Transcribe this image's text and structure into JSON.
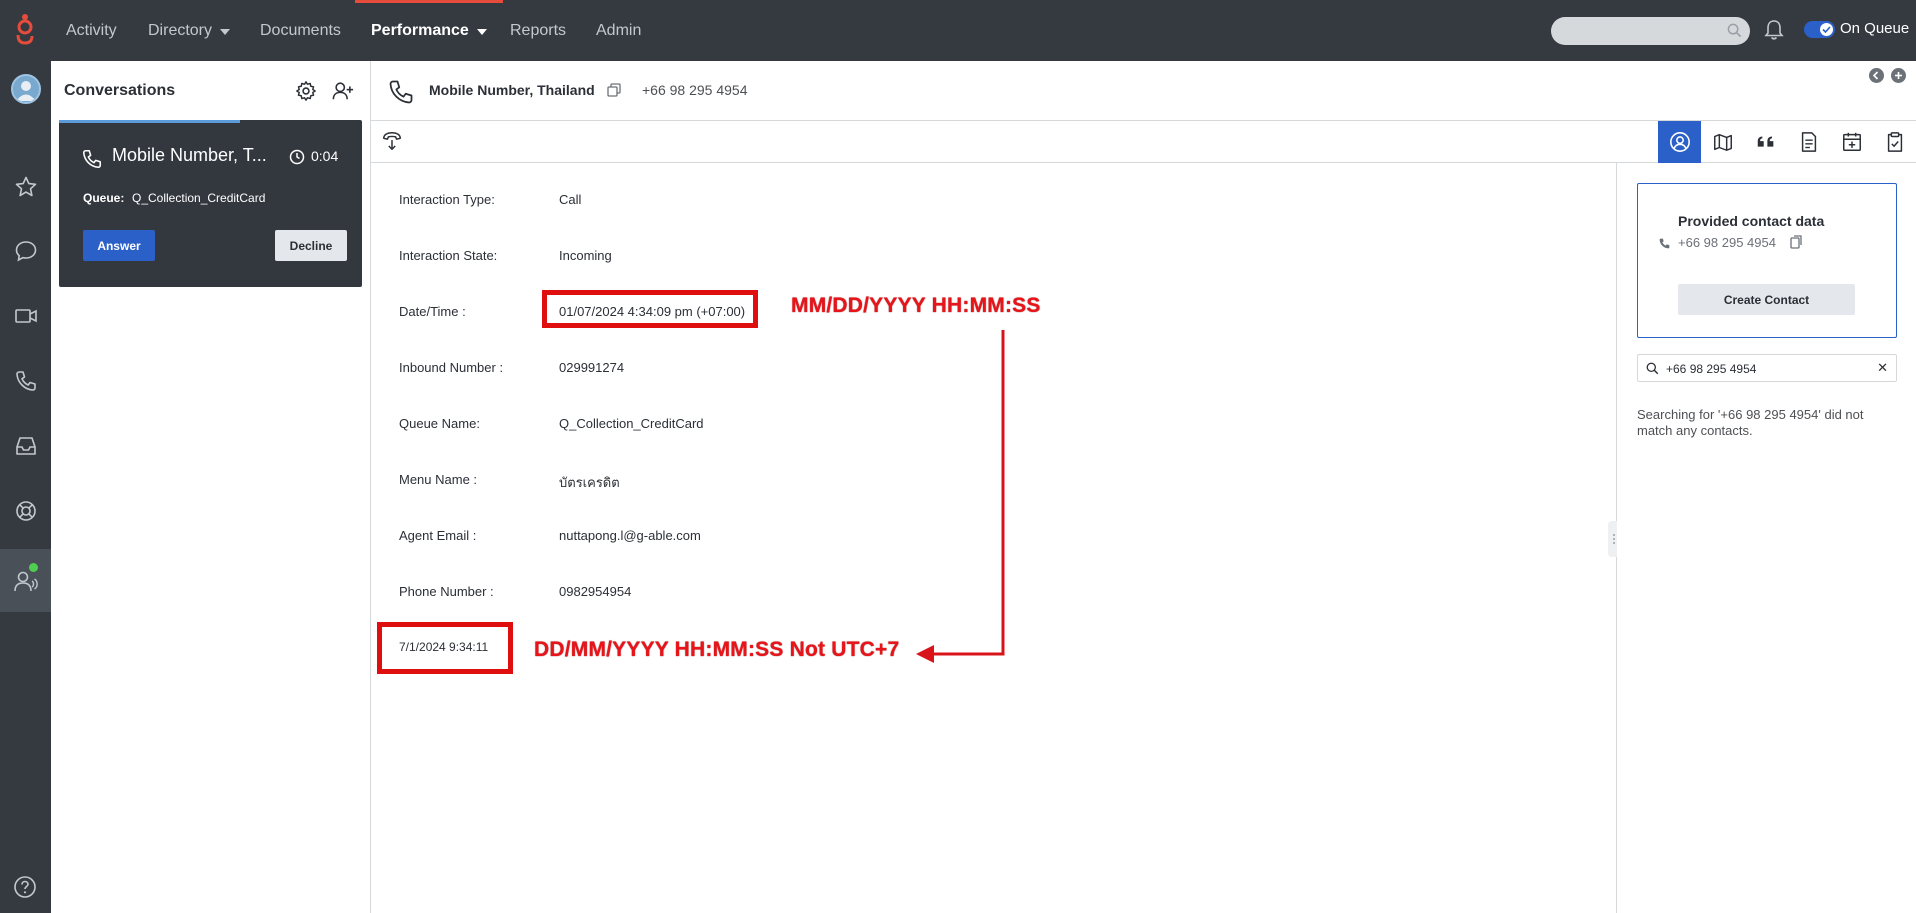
{
  "topnav": {
    "items": [
      {
        "label": "Activity",
        "has_dropdown": false,
        "active": false
      },
      {
        "label": "Directory",
        "has_dropdown": true,
        "active": false
      },
      {
        "label": "Documents",
        "has_dropdown": false,
        "active": false
      },
      {
        "label": "Performance",
        "has_dropdown": true,
        "active": true
      },
      {
        "label": "Reports",
        "has_dropdown": false,
        "active": false
      },
      {
        "label": "Admin",
        "has_dropdown": false,
        "active": false
      }
    ],
    "search_placeholder": "",
    "status_label": "On Queue",
    "accent_color": "#e64c3c"
  },
  "rail": {
    "icons": [
      "avatar",
      "star-icon",
      "chat-icon",
      "video-icon",
      "phone-icon",
      "inbox-icon",
      "lifebuoy-icon",
      "agent-icon",
      "help-icon"
    ]
  },
  "conversations": {
    "title": "Conversations",
    "card": {
      "name": "Mobile Number, T...",
      "elapsed": "0:04",
      "queue_label": "Queue:",
      "queue_value": "Q_Collection_CreditCard",
      "answer_label": "Answer",
      "decline_label": "Decline"
    }
  },
  "interaction": {
    "title": "Mobile Number, Thailand",
    "number": "+66 98 295 4954"
  },
  "details": {
    "rows": [
      {
        "label": "Interaction Type:",
        "value": "Call"
      },
      {
        "label": "Interaction State:",
        "value": "Incoming"
      },
      {
        "label": "Date/Time :",
        "value": "01/07/2024 4:34:09 pm (+07:00)"
      },
      {
        "label": "Inbound Number :",
        "value": "029991274"
      },
      {
        "label": "Queue Name:",
        "value": "Q_Collection_CreditCard"
      },
      {
        "label": "Menu Name :",
        "value": "บัตรเครดิต"
      },
      {
        "label": "Agent Email :",
        "value": "nuttapong.l@g-able.com"
      },
      {
        "label": "Phone Number :",
        "value": "0982954954"
      }
    ],
    "extra_date": "7/1/2024 9:34:11"
  },
  "annotations": {
    "format_top": "MM/DD/YYYY HH:MM:SS",
    "format_bottom": "DD/MM/YYYY HH:MM:SS Not UTC+7",
    "color": "#e00f0f"
  },
  "contact_panel": {
    "title": "Provided contact data",
    "number": "+66 98 295 4954",
    "create_label": "Create Contact",
    "search_value": "+66 98 295 4954",
    "no_match_message": "Searching for '+66 98 295 4954' did not match any contacts."
  }
}
